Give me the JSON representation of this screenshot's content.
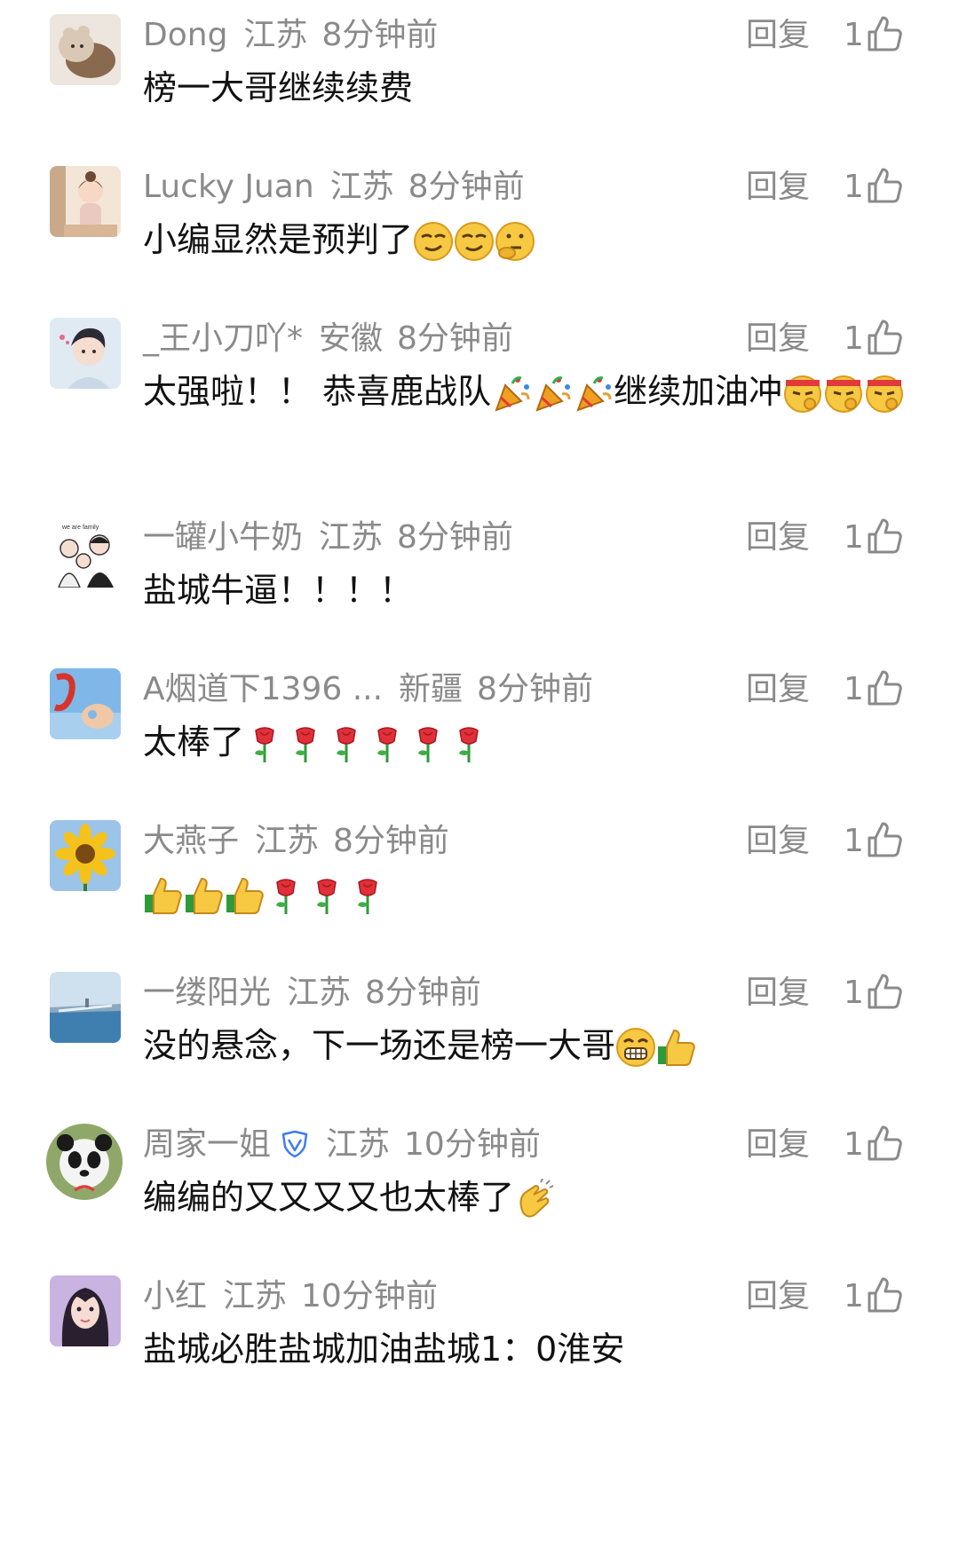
{
  "comments": [
    {
      "user": "Dong",
      "location": "江苏",
      "time": "8分钟前",
      "text": "榜一大哥继续续费",
      "emojis": [],
      "reply_label": "回复",
      "likes": "1",
      "avatar_icon": "bear-plush-icon"
    },
    {
      "user": "Lucky Juan",
      "location": "江苏",
      "time": "8分钟前",
      "text": "小编显然是预判了",
      "emojis": [
        "smirk-face",
        "smirk-face",
        "thinking-face"
      ],
      "reply_label": "回复",
      "likes": "1",
      "avatar_icon": "girl-illustration-icon"
    },
    {
      "user": "_王小刀吖*",
      "location": "安徽",
      "time": "8分钟前",
      "text": "太强啦！！ 恭喜鹿战队",
      "text_after": "继续加油冲",
      "emojis": [
        "party-popper",
        "party-popper",
        "party-popper"
      ],
      "emojis_after": [
        "fighting-face",
        "fighting-face",
        "fighting-face"
      ],
      "reply_label": "回复",
      "likes": "1",
      "avatar_icon": "boy-illustration-icon"
    },
    {
      "user": "一罐小牛奶",
      "location": "江苏",
      "time": "8分钟前",
      "text": "盐城牛逼！！！！",
      "emojis": [],
      "reply_label": "回复",
      "likes": "1",
      "avatar_icon": "family-cartoon-icon"
    },
    {
      "user": "A烟道下1396 ...",
      "location": "新疆",
      "time": "8分钟前",
      "text": "太棒了",
      "emojis": [
        "rose",
        "rose",
        "rose",
        "rose",
        "rose",
        "rose"
      ],
      "reply_label": "回复",
      "likes": "1",
      "avatar_icon": "hand-sky-icon"
    },
    {
      "user": "大燕子",
      "location": "江苏",
      "time": "8分钟前",
      "text": "",
      "emojis": [
        "thumbs-up",
        "thumbs-up",
        "thumbs-up",
        "rose",
        "rose",
        "rose"
      ],
      "reply_label": "回复",
      "likes": "1",
      "avatar_icon": "sunflower-icon"
    },
    {
      "user": "一缕阳光",
      "location": "江苏",
      "time": "8分钟前",
      "text": "没的悬念，下一场还是榜一大哥",
      "emojis": [
        "grin-face",
        "thumbs-up"
      ],
      "reply_label": "回复",
      "likes": "1",
      "avatar_icon": "seaside-icon"
    },
    {
      "user": "周家一姐",
      "location": "江苏",
      "time": "10分钟前",
      "text": "编编的又又又又也太棒了",
      "emojis": [
        "clapping-hands"
      ],
      "reply_label": "回复",
      "likes": "1",
      "avatar_icon": "panda-icon",
      "verified_icon": "vip-shield-icon"
    },
    {
      "user": "小红",
      "location": "江苏",
      "time": "10分钟前",
      "text": "盐城必胜盐城加油盐城1：0淮安",
      "emojis": [],
      "reply_label": "回复",
      "likes": "1",
      "avatar_icon": "woman-portrait-icon"
    }
  ],
  "colors": {
    "meta_text": "#8a8a8a",
    "body_text": "#111111",
    "verified_blue": "#3d7cf0"
  }
}
